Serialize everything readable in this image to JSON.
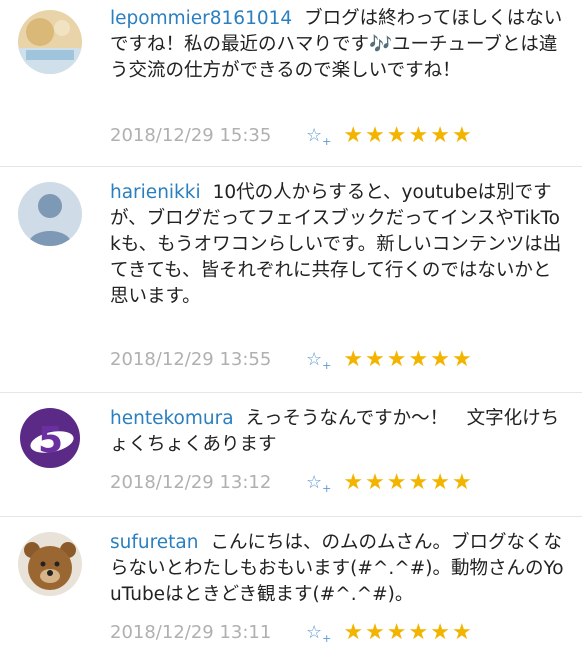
{
  "comments": [
    {
      "username": "lepommier8161014",
      "text": "ブログは終わってほしくはないですね！私の最近のハマりです🎶ユーチューブとは違う交流の仕方ができるので楽しいですね！",
      "time": "2018/12/29 15:35",
      "stars": "★★★★★★"
    },
    {
      "username": "harienikki",
      "text": "10代の人からすると、youtubeは別ですが、ブログだってフェイスブックだってインスやTikTokも、もうオワコンらしいです。新しいコンテンツは出てきても、皆それぞれに共存して行くのではないかと思います。",
      "time": "2018/12/29 13:55",
      "stars": "★★★★★★"
    },
    {
      "username": "hentekomura",
      "text": "えっそうなんですか～！　文字化けちょくちょくあります",
      "time": "2018/12/29 13:12",
      "stars": "★★★★★★"
    },
    {
      "username": "sufuretan",
      "text": "こんにちは、のムのムさん。ブログなくならないとわたしもおもいます(#^.^#)。動物さんのYouTubeはときどき観ます(#^.^#)。",
      "time": "2018/12/29 13:11",
      "stars": "★★★★★★"
    }
  ],
  "icons": {
    "add_star": "☆",
    "add_star_plus": "+"
  },
  "colors": {
    "username": "#2a7fc0",
    "timestamp": "#b0b0b0",
    "star": "#f3b400",
    "add_star": "#5b9bd5"
  }
}
